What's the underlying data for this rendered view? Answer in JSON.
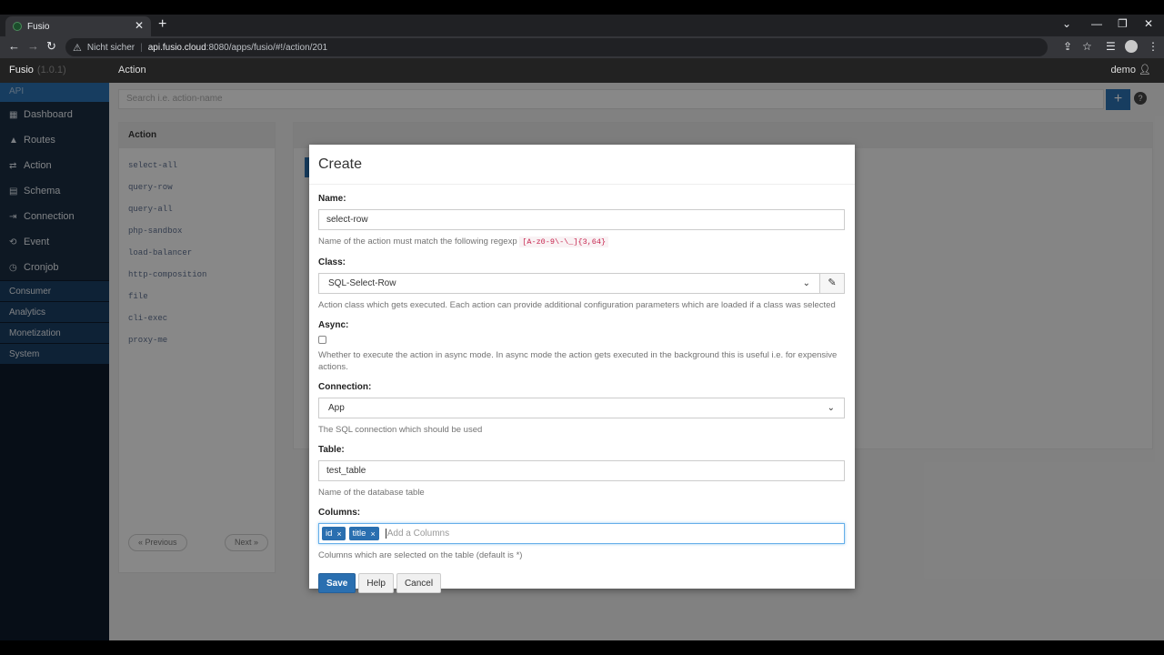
{
  "browser": {
    "tab_title": "Fusio",
    "security_label": "Nicht sicher",
    "url_host": "api.fusio.cloud",
    "url_path": ":8080/apps/fusio/#!/action/201"
  },
  "app": {
    "brand": "Fusio",
    "version": "(1.0.1)",
    "breadcrumb": "Action",
    "user": "demo"
  },
  "sidebar": {
    "section_api": "API",
    "items": [
      {
        "label": "Dashboard",
        "icon": "grid-icon"
      },
      {
        "label": "Routes",
        "icon": "road-icon"
      },
      {
        "label": "Action",
        "icon": "shuffle-icon"
      },
      {
        "label": "Schema",
        "icon": "table-icon"
      },
      {
        "label": "Connection",
        "icon": "login-icon"
      },
      {
        "label": "Event",
        "icon": "retweet-icon"
      },
      {
        "label": "Cronjob",
        "icon": "clock-icon"
      }
    ],
    "sections": [
      "Consumer",
      "Analytics",
      "Monetization",
      "System"
    ]
  },
  "main": {
    "search_placeholder": "Search i.e. action-name",
    "list_header": "Action",
    "actions": [
      "select-all",
      "query-row",
      "query-all",
      "php-sandbox",
      "load-balancer",
      "http-composition",
      "file",
      "cli-exec",
      "proxy-me"
    ],
    "prev_label": "« Previous",
    "next_label": "Next »"
  },
  "modal": {
    "title": "Create",
    "name_label": "Name:",
    "name_value": "select-row",
    "name_help": "Name of the action must match the following regexp",
    "name_regex": "[A-z0-9\\-\\_]{3,64}",
    "class_label": "Class:",
    "class_value": "SQL-Select-Row",
    "class_help": "Action class which gets executed. Each action can provide additional configuration parameters which are loaded if a class was selected",
    "async_label": "Async:",
    "async_help": "Whether to execute the action in async mode. In async mode the action gets executed in the background this is useful i.e. for expensive actions.",
    "connection_label": "Connection:",
    "connection_value": "App",
    "connection_help": "The SQL connection which should be used",
    "table_label": "Table:",
    "table_value": "test_table",
    "table_help": "Name of the database table",
    "columns_label": "Columns:",
    "columns_tags": [
      "id",
      "title"
    ],
    "columns_placeholder": "Add a Columns",
    "columns_help": "Columns which are selected on the table (default is *)",
    "save_label": "Save",
    "help_label": "Help",
    "cancel_label": "Cancel"
  },
  "colors": {
    "accent": "#2a6fb0",
    "sidebar_bg": "#0e1b2b"
  }
}
